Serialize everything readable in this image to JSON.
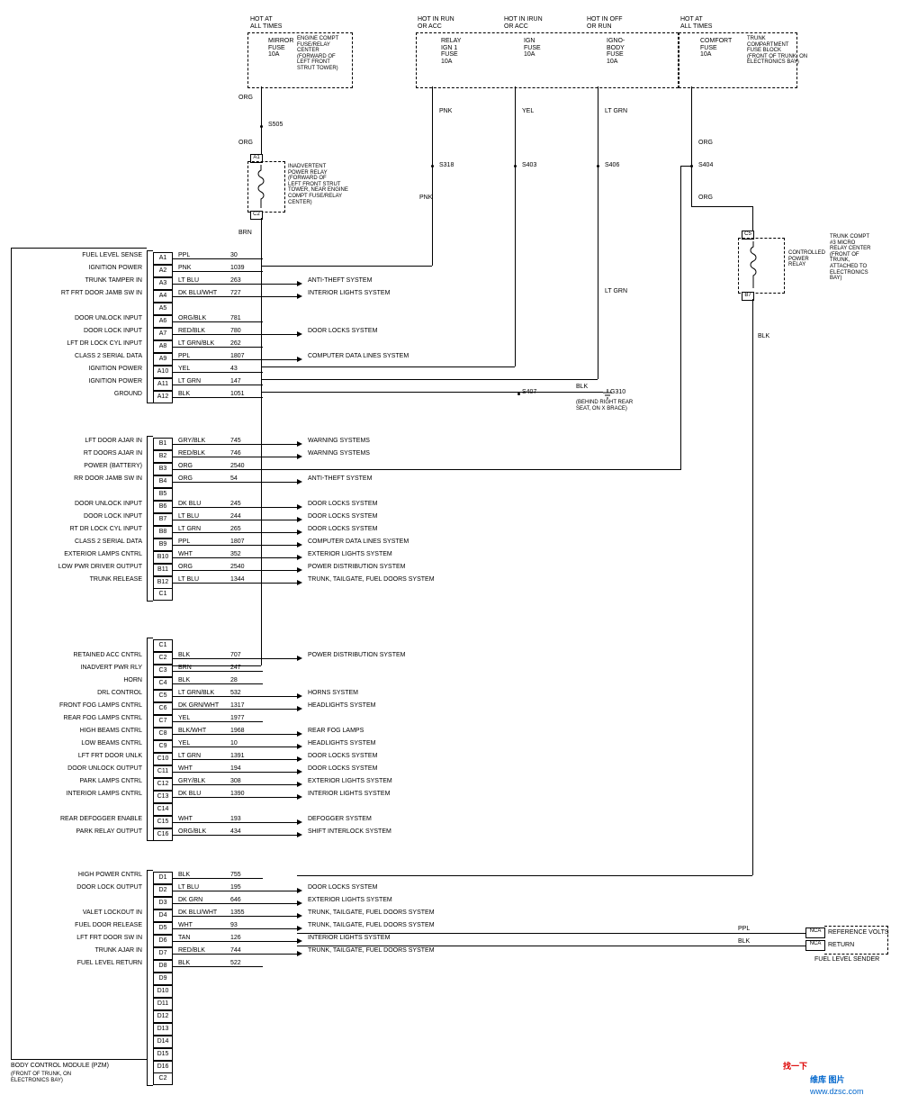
{
  "top_sources": [
    {
      "title": "HOT AT\nALL TIMES",
      "fuse": "MIRROR\nFUSE\n10A",
      "box": "ENGINE COMPT\nFUSE/RELAY\nCENTER\n(FORWARD OF\nLEFT FRONT\nSTRUT TOWER)",
      "wire": "ORG",
      "splice": "S505"
    },
    {
      "title": "HOT IN RUN\nOR ACC",
      "fuse": "RELAY\nIGN 1\nFUSE\n10A",
      "wire": "PNK",
      "splice": "S318"
    },
    {
      "title": "HOT IN IRUN\nOR ACC",
      "fuse": "IGN\nFUSE\n10A",
      "wire": "YEL",
      "splice": "S403"
    },
    {
      "title": "HOT IN OFF\nOR RUN",
      "fuse": "IGNO-\nBODY\nFUSE\n10A",
      "wire": "LT GRN",
      "splice": "S406"
    },
    {
      "title": "HOT AT\nALL TIMES",
      "fuse": "COMFORT\nFUSE\n10A",
      "box": "TRUNK\nCOMPARTMENT\nFUSE BLOCK\n(FRONT OF TRUNK, ON\nELECTRONICS BAY)",
      "wire": "ORG",
      "splice": "S404"
    }
  ],
  "relay1": {
    "name": "INADVERTENT\nPOWER RELAY\n(FORWARD OF\nLEFT FRONT STRUT\nTOWER, NEAR ENGINE\nCOMPT FUSE/RELAY\nCENTER)",
    "pins": [
      "A1",
      "C2"
    ],
    "out": "BRN"
  },
  "relay2": {
    "name": "CONTROLLED\nPOWER\nRELAY",
    "box": "TRUNK COMPT\n#3 MICRO\nRELAY CENTER\n(FRONT OF\nTRUNK,\nATTACHED TO\nELECTRONICS\nBAY)",
    "pins": [
      "C5",
      "B7"
    ],
    "out": "BLK"
  },
  "ground": {
    "splice": "S407",
    "g": "G310",
    "note": "(BEHIND RIGHT REAR\nSEAT, ON X BRACE)",
    "wire": "BLK"
  },
  "bcm": {
    "name": "BODY CONTROL MODULE (PZM)",
    "note": "(FRONT OF TRUNK, ON\nELECTRONICS BAY)"
  },
  "connA": [
    {
      "pin": "A1",
      "sig": "FUEL LEVEL SENSE",
      "color": "PPL",
      "num": "30"
    },
    {
      "pin": "A2",
      "sig": "IGNITION POWER",
      "color": "PNK",
      "num": "1039"
    },
    {
      "pin": "A3",
      "sig": "TRUNK TAMPER IN",
      "color": "LT BLU",
      "num": "263",
      "sys": "ANTI-THEFT SYSTEM"
    },
    {
      "pin": "A4",
      "sig": "RT FRT DOOR JAMB SW IN",
      "color": "DK BLU/WHT",
      "num": "727",
      "sys": "INTERIOR LIGHTS SYSTEM"
    },
    {
      "pin": "A5",
      "sig": ""
    },
    {
      "pin": "A6",
      "sig": "DOOR UNLOCK INPUT",
      "color": "ORG/BLK",
      "num": "781"
    },
    {
      "pin": "A7",
      "sig": "DOOR LOCK INPUT",
      "color": "RED/BLK",
      "num": "780",
      "sys": "DOOR LOCKS SYSTEM"
    },
    {
      "pin": "A8",
      "sig": "LFT DR LOCK CYL INPUT",
      "color": "LT GRN/BLK",
      "num": "262"
    },
    {
      "pin": "A9",
      "sig": "CLASS 2 SERIAL DATA",
      "color": "PPL",
      "num": "1807",
      "sys": "COMPUTER DATA LINES SYSTEM"
    },
    {
      "pin": "A10",
      "sig": "IGNITION POWER",
      "color": "YEL",
      "num": "43"
    },
    {
      "pin": "A11",
      "sig": "IGNITION POWER",
      "color": "LT GRN",
      "num": "147"
    },
    {
      "pin": "A12",
      "sig": "GROUND",
      "color": "BLK",
      "num": "1051"
    }
  ],
  "connB": [
    {
      "pin": "B1",
      "sig": "LFT DOOR AJAR IN",
      "color": "GRY/BLK",
      "num": "745",
      "sys": "WARNING SYSTEMS"
    },
    {
      "pin": "B2",
      "sig": "RT DOORS AJAR IN",
      "color": "RED/BLK",
      "num": "746",
      "sys": "WARNING SYSTEMS"
    },
    {
      "pin": "B3",
      "sig": "POWER (BATTERY)",
      "color": "ORG",
      "num": "2540"
    },
    {
      "pin": "B4",
      "sig": "RR DOOR JAMB SW IN",
      "color": "ORG",
      "num": "54",
      "sys": "ANTI-THEFT SYSTEM"
    },
    {
      "pin": "B5",
      "sig": ""
    },
    {
      "pin": "B6",
      "sig": "DOOR UNLOCK INPUT",
      "color": "DK BLU",
      "num": "245",
      "sys": "DOOR LOCKS SYSTEM"
    },
    {
      "pin": "B7",
      "sig": "DOOR LOCK INPUT",
      "color": "LT BLU",
      "num": "244",
      "sys": "DOOR LOCKS SYSTEM"
    },
    {
      "pin": "B8",
      "sig": "RT DR LOCK CYL INPUT",
      "color": "LT GRN",
      "num": "265",
      "sys": "DOOR LOCKS SYSTEM"
    },
    {
      "pin": "B9",
      "sig": "CLASS 2 SERIAL DATA",
      "color": "PPL",
      "num": "1807",
      "sys": "COMPUTER DATA LINES SYSTEM"
    },
    {
      "pin": "B10",
      "sig": "EXTERIOR LAMPS CNTRL",
      "color": "WHT",
      "num": "352",
      "sys": "EXTERIOR LIGHTS SYSTEM"
    },
    {
      "pin": "B11",
      "sig": "LOW PWR DRIVER OUTPUT",
      "color": "ORG",
      "num": "2540",
      "sys": "POWER DISTRIBUTION SYSTEM"
    },
    {
      "pin": "B12",
      "sig": "TRUNK RELEASE",
      "color": "LT BLU",
      "num": "1344",
      "sys": "TRUNK, TAILGATE, FUEL DOORS SYSTEM"
    }
  ],
  "connB_tail": "C1",
  "connC": [
    {
      "pin": "C1",
      "sig": ""
    },
    {
      "pin": "C2",
      "sig": "RETAINED ACC CNTRL",
      "color": "BLK",
      "num": "707",
      "sys": "POWER DISTRIBUTION SYSTEM"
    },
    {
      "pin": "C3",
      "sig": "INADVERT PWR RLY",
      "color": "BRN",
      "num": "247"
    },
    {
      "pin": "C4",
      "sig": "HORN",
      "color": "BLK",
      "num": "28"
    },
    {
      "pin": "C5",
      "sig": "DRL CONTROL",
      "color": "LT GRN/BLK",
      "num": "532",
      "sys": "HORNS SYSTEM"
    },
    {
      "pin": "C6",
      "sig": "FRONT FOG LAMPS CNTRL",
      "color": "DK GRN/WHT",
      "num": "1317",
      "sys": "HEADLIGHTS SYSTEM"
    },
    {
      "pin": "C7",
      "sig": "REAR FOG LAMPS CNTRL",
      "color": "YEL",
      "num": "1977"
    },
    {
      "pin": "C8",
      "sig": "HIGH BEAMS CNTRL",
      "color": "BLK/WHT",
      "num": "1968",
      "sys": "REAR FOG LAMPS"
    },
    {
      "pin": "C9",
      "sig": "LOW BEAMS CNTRL",
      "color": "YEL",
      "num": "10",
      "sys": "HEADLIGHTS SYSTEM"
    },
    {
      "pin": "C10",
      "sig": "LFT FRT DOOR UNLK",
      "color": "LT GRN",
      "num": "1391",
      "sys": "DOOR LOCKS SYSTEM"
    },
    {
      "pin": "C11",
      "sig": "DOOR UNLOCK OUTPUT",
      "color": "WHT",
      "num": "194",
      "sys": "DOOR LOCKS SYSTEM"
    },
    {
      "pin": "C12",
      "sig": "PARK LAMPS CNTRL",
      "color": "GRY/BLK",
      "num": "308",
      "sys": "EXTERIOR LIGHTS SYSTEM"
    },
    {
      "pin": "C13",
      "sig": "INTERIOR LAMPS CNTRL",
      "color": "DK BLU",
      "num": "1390",
      "sys": "INTERIOR LIGHTS SYSTEM"
    },
    {
      "pin": "C14",
      "sig": ""
    },
    {
      "pin": "C15",
      "sig": "REAR DEFOGGER ENABLE",
      "color": "WHT",
      "num": "193",
      "sys": "DEFOGGER SYSTEM"
    },
    {
      "pin": "C16",
      "sig": "PARK RELAY OUTPUT",
      "color": "ORG/BLK",
      "num": "434",
      "sys": "SHIFT INTERLOCK SYSTEM"
    }
  ],
  "connD": [
    {
      "pin": "D1",
      "sig": "HIGH POWER CNTRL",
      "color": "BLK",
      "num": "755"
    },
    {
      "pin": "D2",
      "sig": "DOOR LOCK OUTPUT",
      "color": "LT BLU",
      "num": "195",
      "sys": "DOOR LOCKS SYSTEM"
    },
    {
      "pin": "D3",
      "sig": "",
      "color": "DK GRN",
      "num": "646",
      "sys": "EXTERIOR LIGHTS SYSTEM"
    },
    {
      "pin": "D4",
      "sig": "VALET LOCKOUT IN",
      "color": "DK BLU/WHT",
      "num": "1355",
      "sys": "TRUNK, TAILGATE, FUEL DOORS SYSTEM"
    },
    {
      "pin": "D5",
      "sig": "FUEL DOOR RELEASE",
      "color": "WHT",
      "num": "93",
      "sys": "TRUNK, TAILGATE, FUEL DOORS SYSTEM"
    },
    {
      "pin": "D6",
      "sig": "LFT FRT DOOR SW IN",
      "color": "TAN",
      "num": "126",
      "sys": "INTERIOR LIGHTS SYSTEM"
    },
    {
      "pin": "D7",
      "sig": "TRUNK AJAR IN",
      "color": "RED/BLK",
      "num": "744",
      "sys": "TRUNK, TAILGATE, FUEL DOORS SYSTEM"
    },
    {
      "pin": "D8",
      "sig": "FUEL LEVEL RETURN",
      "color": "BLK",
      "num": "522"
    },
    {
      "pin": "D9"
    },
    {
      "pin": "D10"
    },
    {
      "pin": "D11"
    },
    {
      "pin": "D12"
    },
    {
      "pin": "D13"
    },
    {
      "pin": "D14"
    },
    {
      "pin": "D15"
    },
    {
      "pin": "D16"
    }
  ],
  "connD_tail": "C2",
  "fuel_sender": {
    "name": "FUEL LEVEL SENDER",
    "ref": "REFERENCE VOLTS",
    "ret": "RETURN",
    "w1": "PPL",
    "w2": "BLK",
    "c": "NCA"
  },
  "footer": {
    "brand": "维库 图片",
    "url": "www.dzsc.com",
    "btn": "找一下"
  }
}
